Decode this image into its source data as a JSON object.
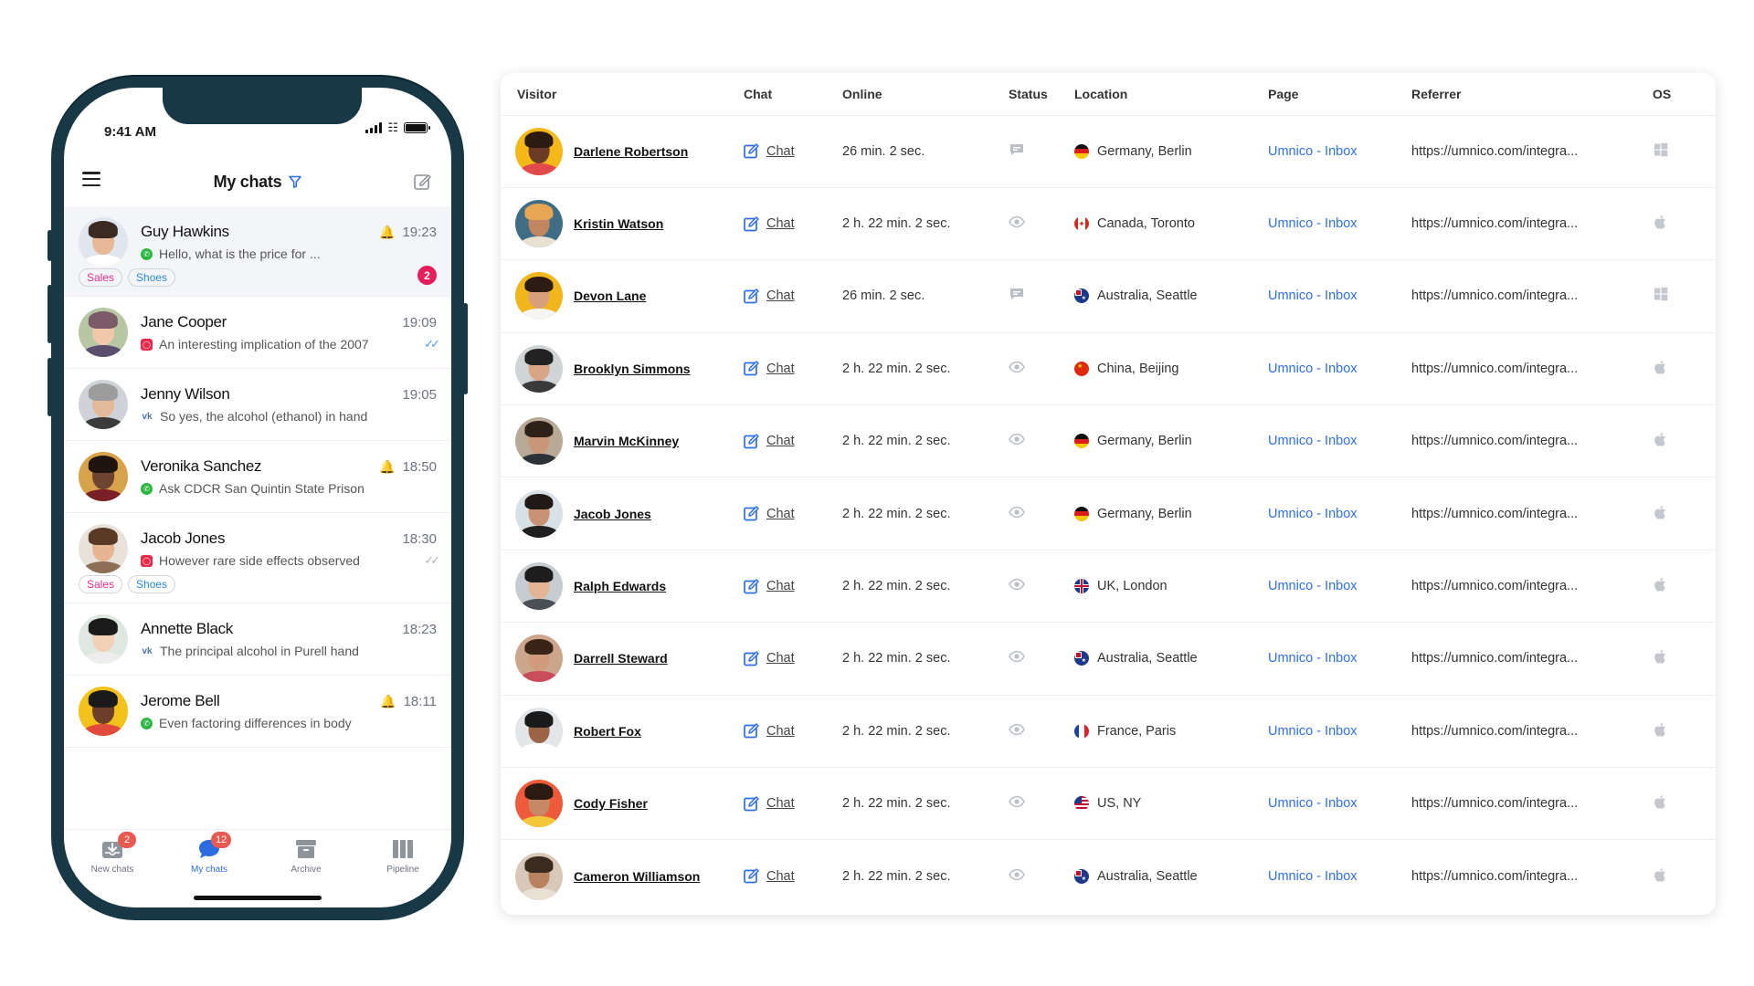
{
  "phone": {
    "status_time": "9:41 AM",
    "header_title": "My chats",
    "chats": [
      {
        "name": "Guy Hawkins",
        "time": "19:23",
        "preview": "Hello, what is the price for ...",
        "channel": "whatsapp",
        "bell": true,
        "tags": [
          "Sales",
          "Shoes"
        ],
        "unread": "2",
        "active": true,
        "avatar_bg": "#dfe6ee",
        "skin": "#e8b897",
        "hair": "#3b2a22",
        "shirt": "#ffffff"
      },
      {
        "name": "Jane Cooper",
        "time": "19:09",
        "preview": "An interesting implication of the 2007",
        "channel": "instagram",
        "ticks": "blue",
        "avatar_bg": "#b7c7a4",
        "skin": "#f0c9ad",
        "hair": "#7c5a68",
        "shirt": "#5a4d6e"
      },
      {
        "name": "Jenny Wilson",
        "time": "19:05",
        "preview": "So yes, the alcohol (ethanol) in hand",
        "channel": "vk",
        "avatar_bg": "#cfd3d8",
        "skin": "#e2b99a",
        "hair": "#9c9c9c",
        "shirt": "#3b3b3b"
      },
      {
        "name": "Veronika Sanchez",
        "time": "18:50",
        "preview": "Ask CDCR San Quintin State Prison",
        "channel": "whatsapp",
        "bell": true,
        "avatar_bg": "#d7a24a",
        "skin": "#6d4331",
        "hair": "#1f140f",
        "shirt": "#7a1f27"
      },
      {
        "name": "Jacob Jones",
        "time": "18:30",
        "preview": "However rare side effects observed",
        "channel": "instagram",
        "ticks": "grey",
        "tags": [
          "Sales",
          "Shoes"
        ],
        "avatar_bg": "#e8e2da",
        "skin": "#e7b592",
        "hair": "#5a3a24",
        "shirt": "#8c6f54"
      },
      {
        "name": "Annette Black",
        "time": "18:23",
        "preview": "The principal alcohol in Purell hand",
        "channel": "vk",
        "avatar_bg": "#dfe8e0",
        "skin": "#f1d0b5",
        "hair": "#1b1b1b",
        "shirt": "#ededed"
      },
      {
        "name": "Jerome Bell",
        "time": "18:11",
        "preview": "Even factoring differences in body",
        "channel": "whatsapp",
        "bell": true,
        "avatar_bg": "#f2c21b",
        "skin": "#6b3f2a",
        "hair": "#1a1a1a",
        "shirt": "#e24b3b"
      }
    ],
    "tabs": [
      {
        "label": "New chats",
        "badge": "2"
      },
      {
        "label": "My chats",
        "badge": "12"
      },
      {
        "label": "Archive"
      },
      {
        "label": "Pipeline"
      }
    ]
  },
  "table": {
    "headers": [
      "Visitor",
      "Chat",
      "Online",
      "Status",
      "Location",
      "Page",
      "Referrer",
      "OS"
    ],
    "rows": [
      {
        "visitor": "Darlene Robertson",
        "chat": "Chat",
        "online": "26 min. 2 sec.",
        "status": "message",
        "location": "Germany, Berlin",
        "flag": "de",
        "page": "Umnico - Inbox",
        "referrer": "https://umnico.com/integra...",
        "os": "windows",
        "avatar_bg": "#f4b818",
        "skin": "#6a3c25",
        "hair": "#2a1a12",
        "shirt": "#e14a4a"
      },
      {
        "visitor": "Kristin Watson",
        "chat": "Chat",
        "online": "2 h. 22 min. 2 sec.",
        "status": "viewing",
        "location": "Canada, Toronto",
        "flag": "ca",
        "page": "Umnico - Inbox",
        "referrer": "https://umnico.com/integra...",
        "os": "apple",
        "avatar_bg": "#3f6d86",
        "skin": "#c18560",
        "hair": "#e7a653",
        "shirt": "#e9e2d2"
      },
      {
        "visitor": "Devon Lane",
        "chat": "Chat",
        "online": "26 min. 2 sec.",
        "status": "message",
        "location": "Australia, Seattle",
        "flag": "au",
        "page": "Umnico - Inbox",
        "referrer": "https://umnico.com/integra...",
        "os": "windows",
        "avatar_bg": "#f1b61c",
        "skin": "#d8a07a",
        "hair": "#2d1c14",
        "shirt": "#f5f5f5"
      },
      {
        "visitor": "Brooklyn Simmons",
        "chat": "Chat",
        "online": "2 h. 22 min. 2 sec.",
        "status": "viewing",
        "location": "China, Beijing",
        "flag": "cn",
        "page": "Umnico - Inbox",
        "referrer": "https://umnico.com/integra...",
        "os": "apple",
        "avatar_bg": "#cfd4d6",
        "skin": "#d9a685",
        "hair": "#222222",
        "shirt": "#3a3a3a"
      },
      {
        "visitor": "Marvin McKinney",
        "chat": "Chat",
        "online": "2 h. 22 min. 2 sec.",
        "status": "viewing",
        "location": "Germany, Berlin",
        "flag": "de",
        "page": "Umnico - Inbox",
        "referrer": "https://umnico.com/integra...",
        "os": "apple",
        "avatar_bg": "#b9aa98",
        "skin": "#c99776",
        "hair": "#2e2218",
        "shirt": "#2d3238"
      },
      {
        "visitor": "Jacob Jones",
        "chat": "Chat",
        "online": "2 h. 22 min. 2 sec.",
        "status": "viewing",
        "location": "Germany, Berlin",
        "flag": "de",
        "page": "Umnico - Inbox",
        "referrer": "https://umnico.com/integra...",
        "os": "apple",
        "avatar_bg": "#d8e1e6",
        "skin": "#c89273",
        "hair": "#1f1a16",
        "shirt": "#1f1f1f"
      },
      {
        "visitor": "Ralph Edwards",
        "chat": "Chat",
        "online": "2 h. 22 min. 2 sec.",
        "status": "viewing",
        "location": "UK, London",
        "flag": "uk",
        "page": "Umnico - Inbox",
        "referrer": "https://umnico.com/integra...",
        "os": "apple",
        "avatar_bg": "#c6ccd0",
        "skin": "#e3b496",
        "hair": "#1d1d1d",
        "shirt": "#4b5057"
      },
      {
        "visitor": "Darrell Steward",
        "chat": "Chat",
        "online": "2 h. 22 min. 2 sec.",
        "status": "viewing",
        "location": "Australia, Seattle",
        "flag": "au",
        "page": "Umnico - Inbox",
        "referrer": "https://umnico.com/integra...",
        "os": "apple",
        "avatar_bg": "#cba68b",
        "skin": "#cf9b7a",
        "hair": "#3a2418",
        "shirt": "#c94d5a"
      },
      {
        "visitor": "Robert Fox",
        "chat": "Chat",
        "online": "2 h. 22 min. 2 sec.",
        "status": "viewing",
        "location": "France, Paris",
        "flag": "fr",
        "page": "Umnico - Inbox",
        "referrer": "https://umnico.com/integra...",
        "os": "apple",
        "avatar_bg": "#e3e6e9",
        "skin": "#9a6446",
        "hair": "#1a1a1a",
        "shirt": "#ffffff"
      },
      {
        "visitor": "Cody Fisher",
        "chat": "Chat",
        "online": "2 h. 22 min. 2 sec.",
        "status": "viewing",
        "location": "US, NY",
        "flag": "us",
        "page": "Umnico - Inbox",
        "referrer": "https://umnico.com/integra...",
        "os": "apple",
        "avatar_bg": "#ee5a3a",
        "skin": "#c58966",
        "hair": "#2a1a12",
        "shirt": "#f3c83a"
      },
      {
        "visitor": "Cameron Williamson",
        "chat": "Chat",
        "online": "2 h. 22 min. 2 sec.",
        "status": "viewing",
        "location": "Australia, Seattle",
        "flag": "au",
        "page": "Umnico - Inbox",
        "referrer": "https://umnico.com/integra...",
        "os": "apple",
        "avatar_bg": "#d7c8b8",
        "skin": "#b9825f",
        "hair": "#3a2a1f",
        "shirt": "#e9dfd3"
      }
    ]
  },
  "colors": {
    "accent": "#2f6fe4",
    "bell": "#d51fd1",
    "unread_badge": "#e51d5a",
    "phone_frame": "#173844",
    "tag_sales": "#e02f8d",
    "tag_shoes": "#2b8ad9"
  }
}
